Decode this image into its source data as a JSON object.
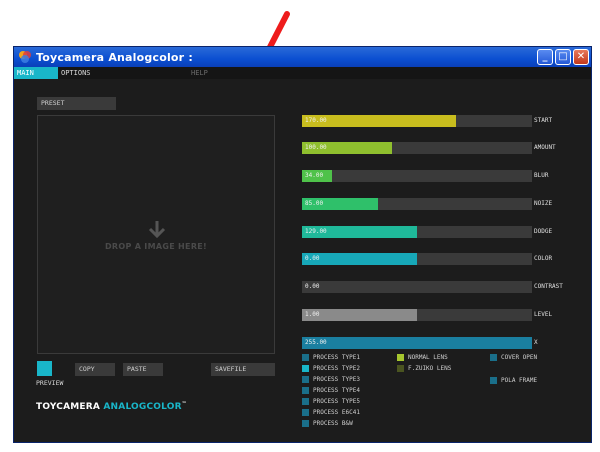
{
  "window": {
    "title": "Toycamera Analogcolor :",
    "min_glyph": "_",
    "max_glyph": "□",
    "close_glyph": "✕"
  },
  "menu": {
    "items": [
      {
        "label": "MAIN",
        "active": true
      },
      {
        "label": "OPTIONS",
        "active": false
      },
      {
        "label": "HELP",
        "active": false
      }
    ]
  },
  "panel": {
    "preset_label": "PRESET",
    "drop_text": "DROP A IMAGE HERE!",
    "preview_label": "PREVIEW",
    "copy_label": "COPY",
    "paste_label": "PASTE",
    "savefile_label": "SAVEFILE",
    "brand_main": "TOYCAMERA ",
    "brand_accent": "ANALOGCOLOR",
    "brand_tm": "™"
  },
  "sliders": [
    {
      "label": "START",
      "value": "170.00",
      "fill": 0.67,
      "color": "#c8bd1e"
    },
    {
      "label": "AMOUNT",
      "value": "100.00",
      "fill": 0.39,
      "color": "#8fbf2e"
    },
    {
      "label": "BLUR",
      "value": "34.00",
      "fill": 0.13,
      "color": "#4fc24a"
    },
    {
      "label": "NOIZE",
      "value": "85.00",
      "fill": 0.33,
      "color": "#2fc06a"
    },
    {
      "label": "DODGE",
      "value": "129.00",
      "fill": 0.5,
      "color": "#1fb99a"
    },
    {
      "label": "COLOR",
      "value": "0.00",
      "fill": 0.5,
      "color": "#17a8b8"
    },
    {
      "label": "CONTRAST",
      "value": "0.00",
      "fill": 0.0,
      "color": "#3a3a3a"
    },
    {
      "label": "LEVEL",
      "value": "1.00",
      "fill": 0.5,
      "color": "#8a8a8a"
    },
    {
      "label": "X",
      "value": "255.00",
      "fill": 1.0,
      "color": "#1a7fa0"
    }
  ],
  "options": {
    "process_types": [
      {
        "label": "PROCESS TYPE1",
        "color": "#1a6f8a"
      },
      {
        "label": "PROCESS TYPE2",
        "color": "#19b6c9"
      },
      {
        "label": "PROCESS TYPE3",
        "color": "#1a6f8a"
      },
      {
        "label": "PROCESS TYPE4",
        "color": "#1a6f8a"
      },
      {
        "label": "PROCESS TYPE5",
        "color": "#1a6f8a"
      },
      {
        "label": "PROCESS E6C41",
        "color": "#1a6f8a"
      },
      {
        "label": "PROCESS B&W",
        "color": "#1a6f8a"
      }
    ],
    "lenses": [
      {
        "label": "NORMAL LENS",
        "color": "#a6c62e"
      },
      {
        "label": "F.ZUIKO LENS",
        "color": "#4a5420"
      }
    ],
    "extras": [
      {
        "label": "COVER OPEN",
        "color": "#1a6f8a"
      },
      {
        "label": "POLA FRAME",
        "color": "#1a6f8a"
      }
    ]
  },
  "colors": {
    "accent": "#19b6c9",
    "annotation_arrow": "#ee1c1c"
  }
}
